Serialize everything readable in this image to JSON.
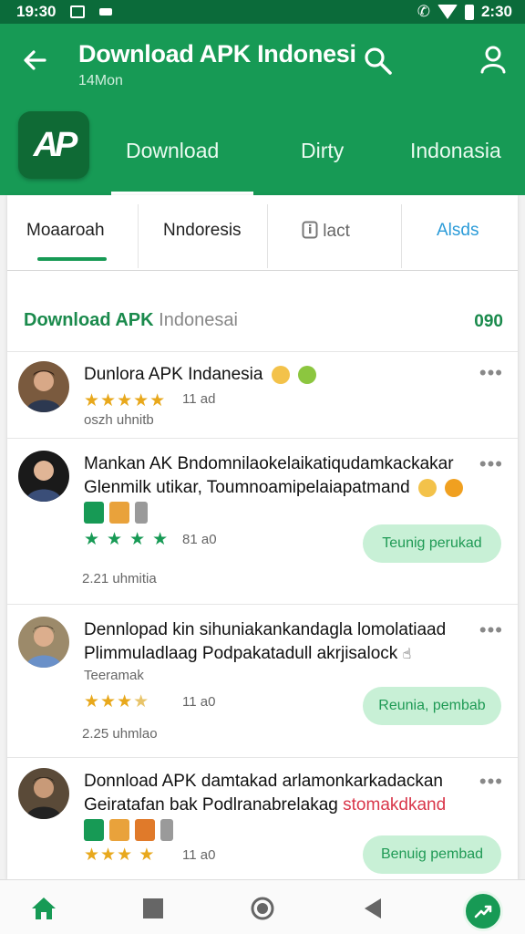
{
  "status_bar": {
    "time": "19:30",
    "right_time": "2:30"
  },
  "app_bar": {
    "title": "Download APK Indonesi",
    "subtitle": "14Mon",
    "logo_text": "AP",
    "tabs": [
      {
        "label": "Download",
        "selected": true
      },
      {
        "label": "Dirty",
        "selected": false
      },
      {
        "label": "Indonasia",
        "selected": false
      }
    ]
  },
  "sub_tabs": [
    {
      "label": "Moaaroah",
      "selected": true
    },
    {
      "label": "Nndoresis",
      "selected": false
    },
    {
      "label": "lact",
      "icon": "info-icon",
      "selected": false
    },
    {
      "label": "Alsds",
      "selected": false,
      "color": "#2b9bd8"
    }
  ],
  "section": {
    "title_bold": "Download APK",
    "title_light": "Indonesai",
    "count": "090"
  },
  "reviews": [
    {
      "title": "Dunlora APK Indanesia",
      "rating": 5,
      "time": "11 ad",
      "footer": "oszh uhnitb",
      "more": "•••"
    },
    {
      "title": "Mankan AK Bndomnilaokelaikatiqudamkackakar",
      "line2": "Glenmilk utikar, Toumnoamipelaiapatmand",
      "rating": 4,
      "time": "81 a0",
      "action": "Teunig perukad",
      "footer": "2.21 uhmitia",
      "more": "•••"
    },
    {
      "title": "Dennlopad kin sihuniakankandagla lomolatiaad",
      "line2": "Plimmuladlaag Podpakatadull akrjisalock",
      "line3": "Teeramak",
      "rating": 3.5,
      "time": "11 a0",
      "action": "Reunia, pembab",
      "footer": "2.25 uhmlao",
      "more": "•••"
    },
    {
      "title": "Donnload APK damtakad arlamonkarkadackan",
      "line2_a": "Geiratafan bak Podlranabrelakag",
      "line2_b": "stomakdkand",
      "rating": 3,
      "time": "11 a0",
      "action": "Benuig pembad",
      "more": "•••"
    }
  ],
  "colors": {
    "primary": "#179a55",
    "status_bar": "#0b6b3a",
    "pill_bg": "#c8f0d6",
    "star": "#e8a81c",
    "link_blue": "#2b9bd8",
    "red_text": "#d9364a"
  }
}
